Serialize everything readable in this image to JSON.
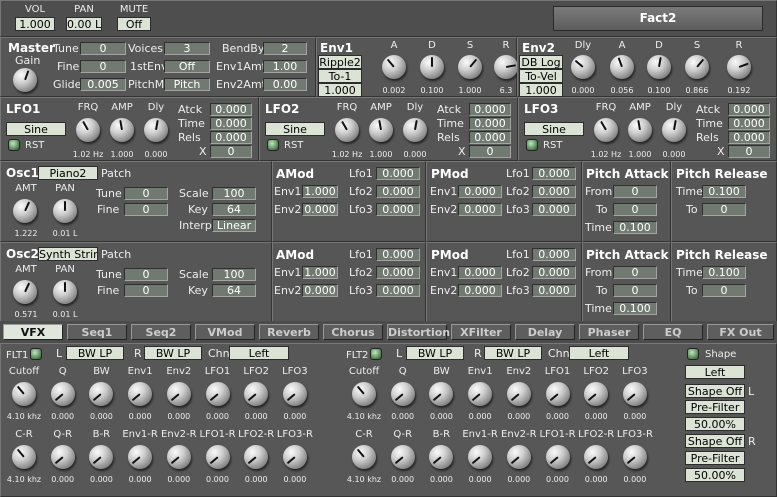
{
  "top": {
    "vol_label": "VOL",
    "vol": "1.000",
    "pan_label": "PAN",
    "pan": "0.00 L",
    "mute_label": "MUTE",
    "mute": "Off",
    "preset": "Fact2"
  },
  "master": {
    "title": "Master",
    "gain_label": "Gain",
    "tune_label": "Tune",
    "tune": "0",
    "fine_label": "Fine",
    "fine": "0",
    "glide_label": "Glide",
    "glide": "0.005",
    "voices_label": "Voices",
    "voices": "3",
    "firstenv_label": "1stEnv",
    "firstenv": "Off",
    "pitchm_label": "PitchM",
    "pitchm": "Pitch",
    "bendby_label": "BendBy",
    "bendby": "2",
    "env1amt_label": "Env1Amt",
    "env1amt": "1.00",
    "env2amt_label": "Env2Amt",
    "env2amt": "0.00"
  },
  "env1": {
    "title": "Env1",
    "mode": "Ripple2",
    "vel": "To-1",
    "amt": "1.000",
    "labels": [
      "A",
      "D",
      "S",
      "R"
    ],
    "values": [
      "0.002",
      "0.100",
      "1.000",
      "6.3"
    ]
  },
  "env2": {
    "title": "Env2",
    "mode": "DB Log",
    "vel": "To-Vel",
    "amt": "1.000",
    "labels": [
      "Dly",
      "A",
      "D",
      "S",
      "R"
    ],
    "values": [
      "0.000",
      "0.056",
      "0.100",
      "0.866",
      "0.192"
    ]
  },
  "lfo_common": {
    "frq": "FRQ",
    "amp": "AMP",
    "dly": "Dly",
    "rst": "RST",
    "atck": "Atck",
    "time": "Time",
    "rels": "Rels",
    "x": "X"
  },
  "lfos": [
    {
      "title": "LFO1",
      "wave": "Sine",
      "frq": "1.02 Hz",
      "amp": "1.000",
      "dly": "0.000",
      "atck": "0.000",
      "time": "0.000",
      "rels": "0.000",
      "x": "0"
    },
    {
      "title": "LFO2",
      "wave": "Sine",
      "frq": "1.02 Hz",
      "amp": "1.000",
      "dly": "0.000",
      "atck": "0.000",
      "time": "0.000",
      "rels": "0.000",
      "x": "0"
    },
    {
      "title": "LFO3",
      "wave": "Sine",
      "frq": "1.02 Hz",
      "amp": "1.000",
      "dly": "0.000",
      "atck": "0.000",
      "time": "0.000",
      "rels": "0.000",
      "x": "0"
    }
  ],
  "osc_common": {
    "amt": "AMT",
    "pan": "PAN",
    "patch": "Patch",
    "tune": "Tune",
    "fine": "Fine",
    "scale": "Scale",
    "key": "Key",
    "interp": "Interp",
    "amod": "AMod",
    "pmod": "PMod",
    "env1": "Env1",
    "env2": "Env2",
    "lfo1": "Lfo1",
    "lfo2": "Lfo2",
    "lfo3": "Lfo3",
    "pitch_attack": "Pitch Attack",
    "pitch_release": "Pitch Release",
    "from": "From",
    "to": "To",
    "time": "Time"
  },
  "osc1": {
    "title": "Osc1",
    "patch": "Piano2",
    "amt": "1.222",
    "pan": "0.01 L",
    "tune": "0",
    "fine": "0",
    "scale": "100",
    "key": "64",
    "interp": "Linear",
    "amod": {
      "env1": "1.000",
      "env2": "0.000",
      "lfo1": "0.000",
      "lfo2": "0.000",
      "lfo3": "0.000"
    },
    "pmod": {
      "env1": "0.000",
      "env2": "0.000",
      "lfo1": "0.000",
      "lfo2": "0.000",
      "lfo3": "0.000"
    },
    "pa": {
      "from": "0",
      "to": "0",
      "time": "0.100"
    },
    "pr": {
      "time": "0.100",
      "to": "0"
    }
  },
  "osc2": {
    "title": "Osc2",
    "patch": "Synth String",
    "amt": "0.571",
    "pan": "0.01 L",
    "tune": "0",
    "fine": "0",
    "scale": "100",
    "key": "64",
    "amod": {
      "env1": "1.000",
      "env2": "0.000",
      "lfo1": "0.000",
      "lfo2": "0.000",
      "lfo3": "0.000"
    },
    "pmod": {
      "env1": "0.000",
      "env2": "0.000",
      "lfo1": "0.000",
      "lfo2": "0.000",
      "lfo3": "0.000"
    },
    "pa": {
      "from": "0",
      "to": "0",
      "time": "0.100"
    },
    "pr": {
      "time": "0.100",
      "to": "0"
    }
  },
  "tabs": [
    "VFX",
    "Seq1",
    "Seq2",
    "VMod",
    "Reverb",
    "Chorus",
    "Distortion",
    "XFilter",
    "Delay",
    "Phaser",
    "EQ",
    "FX Out"
  ],
  "active_tab": "VFX",
  "flt_common": {
    "l": "L",
    "r": "R",
    "chn": "Chn",
    "row1": [
      "Cutoff",
      "Q",
      "BW",
      "Env1",
      "Env2",
      "LFO1",
      "LFO2",
      "LFO3"
    ],
    "row2": [
      "C-R",
      "Q-R",
      "B-R",
      "Env1-R",
      "Env2-R",
      "LFO1-R",
      "LFO2-R",
      "LFO3-R"
    ]
  },
  "flt1": {
    "title": "FLT1",
    "l": "BW LP",
    "r": "BW LP",
    "chn": "Left",
    "row1": [
      "4.10 khz",
      "0.000",
      "0.000",
      "0.000",
      "0.000",
      "0.000",
      "0.000",
      "0.000"
    ],
    "row2": [
      "4.10 khz",
      "0.000",
      "0.000",
      "0.000",
      "0.000",
      "0.000",
      "0.000",
      "0.000"
    ]
  },
  "flt2": {
    "title": "FLT2",
    "l": "BW LP",
    "r": "BW LP",
    "chn": "Left",
    "row1": [
      "4.10 khz",
      "0.000",
      "0.000",
      "0.000",
      "0.000",
      "0.000",
      "0.000",
      "0.000"
    ],
    "row2": [
      "4.10 khz",
      "0.000",
      "0.000",
      "0.000",
      "0.000",
      "0.000",
      "0.000",
      "0.000"
    ]
  },
  "shape": {
    "label": "Shape",
    "mode": "Left",
    "l_label": "L",
    "r_label": "R",
    "l_shape": "Shape Off",
    "l_filter": "Pre-Filter",
    "l_pct": "50.00%",
    "r_shape": "Shape Off",
    "r_filter": "Pre-Filter",
    "r_pct": "50.00%"
  }
}
